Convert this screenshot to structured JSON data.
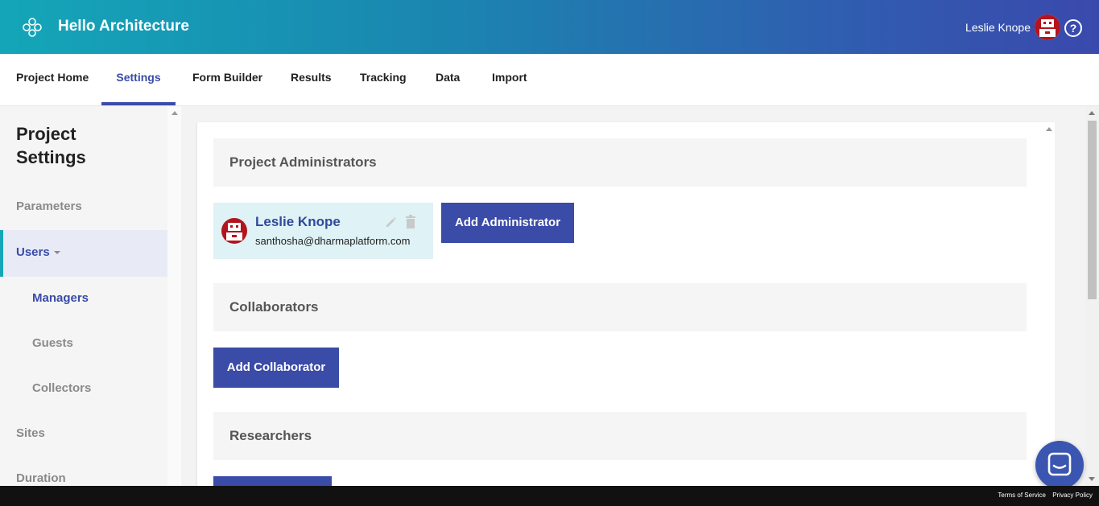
{
  "app": {
    "title": "Hello Architecture",
    "user_name": "Leslie Knope",
    "help_glyph": "?"
  },
  "nav": {
    "tabs": [
      {
        "label": "Project Home"
      },
      {
        "label": "Settings"
      },
      {
        "label": "Form Builder"
      },
      {
        "label": "Results"
      },
      {
        "label": "Tracking"
      },
      {
        "label": "Data"
      },
      {
        "label": "Import"
      }
    ],
    "active_tab": "Settings"
  },
  "sidebar": {
    "title_line1": "Project",
    "title_line2": "Settings",
    "items": [
      {
        "label": "Parameters"
      },
      {
        "label": "Users"
      },
      {
        "label": "Managers"
      },
      {
        "label": "Guests"
      },
      {
        "label": "Collectors"
      },
      {
        "label": "Sites"
      },
      {
        "label": "Duration"
      }
    ]
  },
  "main": {
    "admins_heading": "Project Administrators",
    "admin": {
      "name": "Leslie Knope",
      "email": "santhosha@dharmaplatform.com"
    },
    "add_admin_label": "Add Administrator",
    "collab_heading": "Collaborators",
    "add_collab_label": "Add Collaborator",
    "research_heading": "Researchers"
  },
  "footer": {
    "terms": "Terms of Service",
    "privacy": "Privacy Policy"
  },
  "colors": {
    "brand": "#3a4ba8",
    "accent": "#14a6b8",
    "chip_bg": "#dff2f5"
  }
}
